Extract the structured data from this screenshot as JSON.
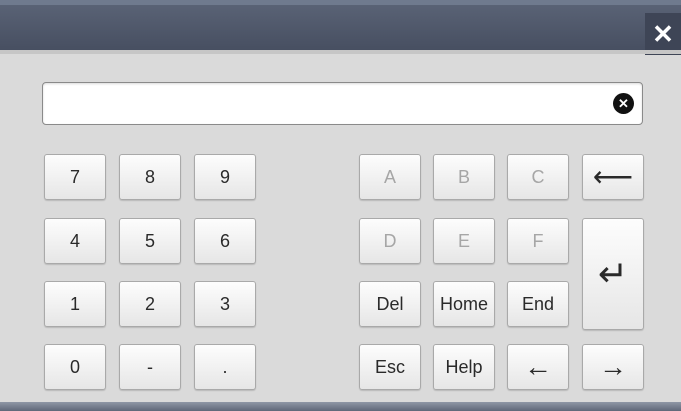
{
  "window": {
    "close_symbol": "✕"
  },
  "input": {
    "value": "",
    "placeholder": "",
    "clear_symbol": "✕"
  },
  "numpad": {
    "row1": [
      "7",
      "8",
      "9"
    ],
    "row2": [
      "4",
      "5",
      "6"
    ],
    "row3": [
      "1",
      "2",
      "3"
    ],
    "row4": [
      "0",
      "-",
      "."
    ]
  },
  "letters": {
    "row1": [
      "A",
      "B",
      "C"
    ],
    "row2": [
      "D",
      "E",
      "F"
    ],
    "disabled": true
  },
  "edit_keys": {
    "del": "Del",
    "home": "Home",
    "end": "End",
    "esc": "Esc",
    "help": "Help"
  },
  "arrows": {
    "backspace": "⟵",
    "enter": "↵",
    "left": "←",
    "right": "→"
  },
  "colors": {
    "titlebar": "#4f576a",
    "background": "#dadada",
    "key_text": "#2a2a2a",
    "key_disabled_text": "#a6a6a6"
  }
}
